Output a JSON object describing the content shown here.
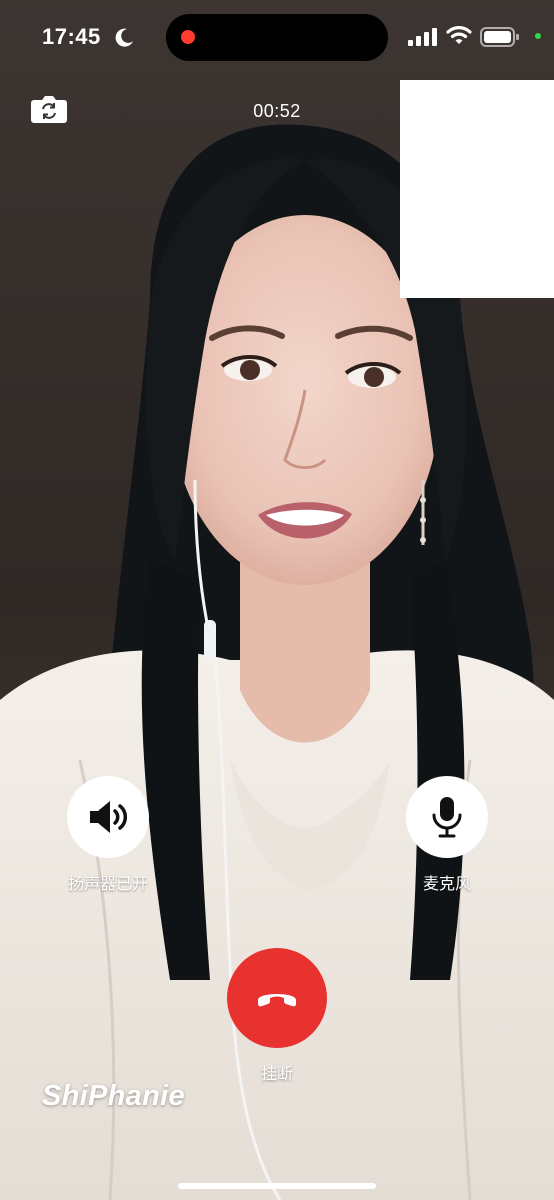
{
  "status_bar": {
    "time": "17:45",
    "moon_icon": "moon-icon",
    "signal_icon": "cellular-signal-icon",
    "wifi_icon": "wifi-icon",
    "battery_icon": "battery-icon",
    "recording_indicator_color": "#ff3b30",
    "privacy_indicator_color": "#32d74b"
  },
  "call": {
    "timer": "00:52",
    "switch_camera_icon": "switch-camera-icon"
  },
  "controls": {
    "speaker_label": "扬声器已开",
    "speaker_icon": "speaker-on-icon",
    "mic_label": "麦克风",
    "mic_icon": "microphone-icon",
    "hangup_label": "挂断",
    "hangup_icon": "phone-hangup-icon",
    "hangup_color": "#e8322f"
  },
  "watermark": {
    "text": "ShiPhanie"
  }
}
